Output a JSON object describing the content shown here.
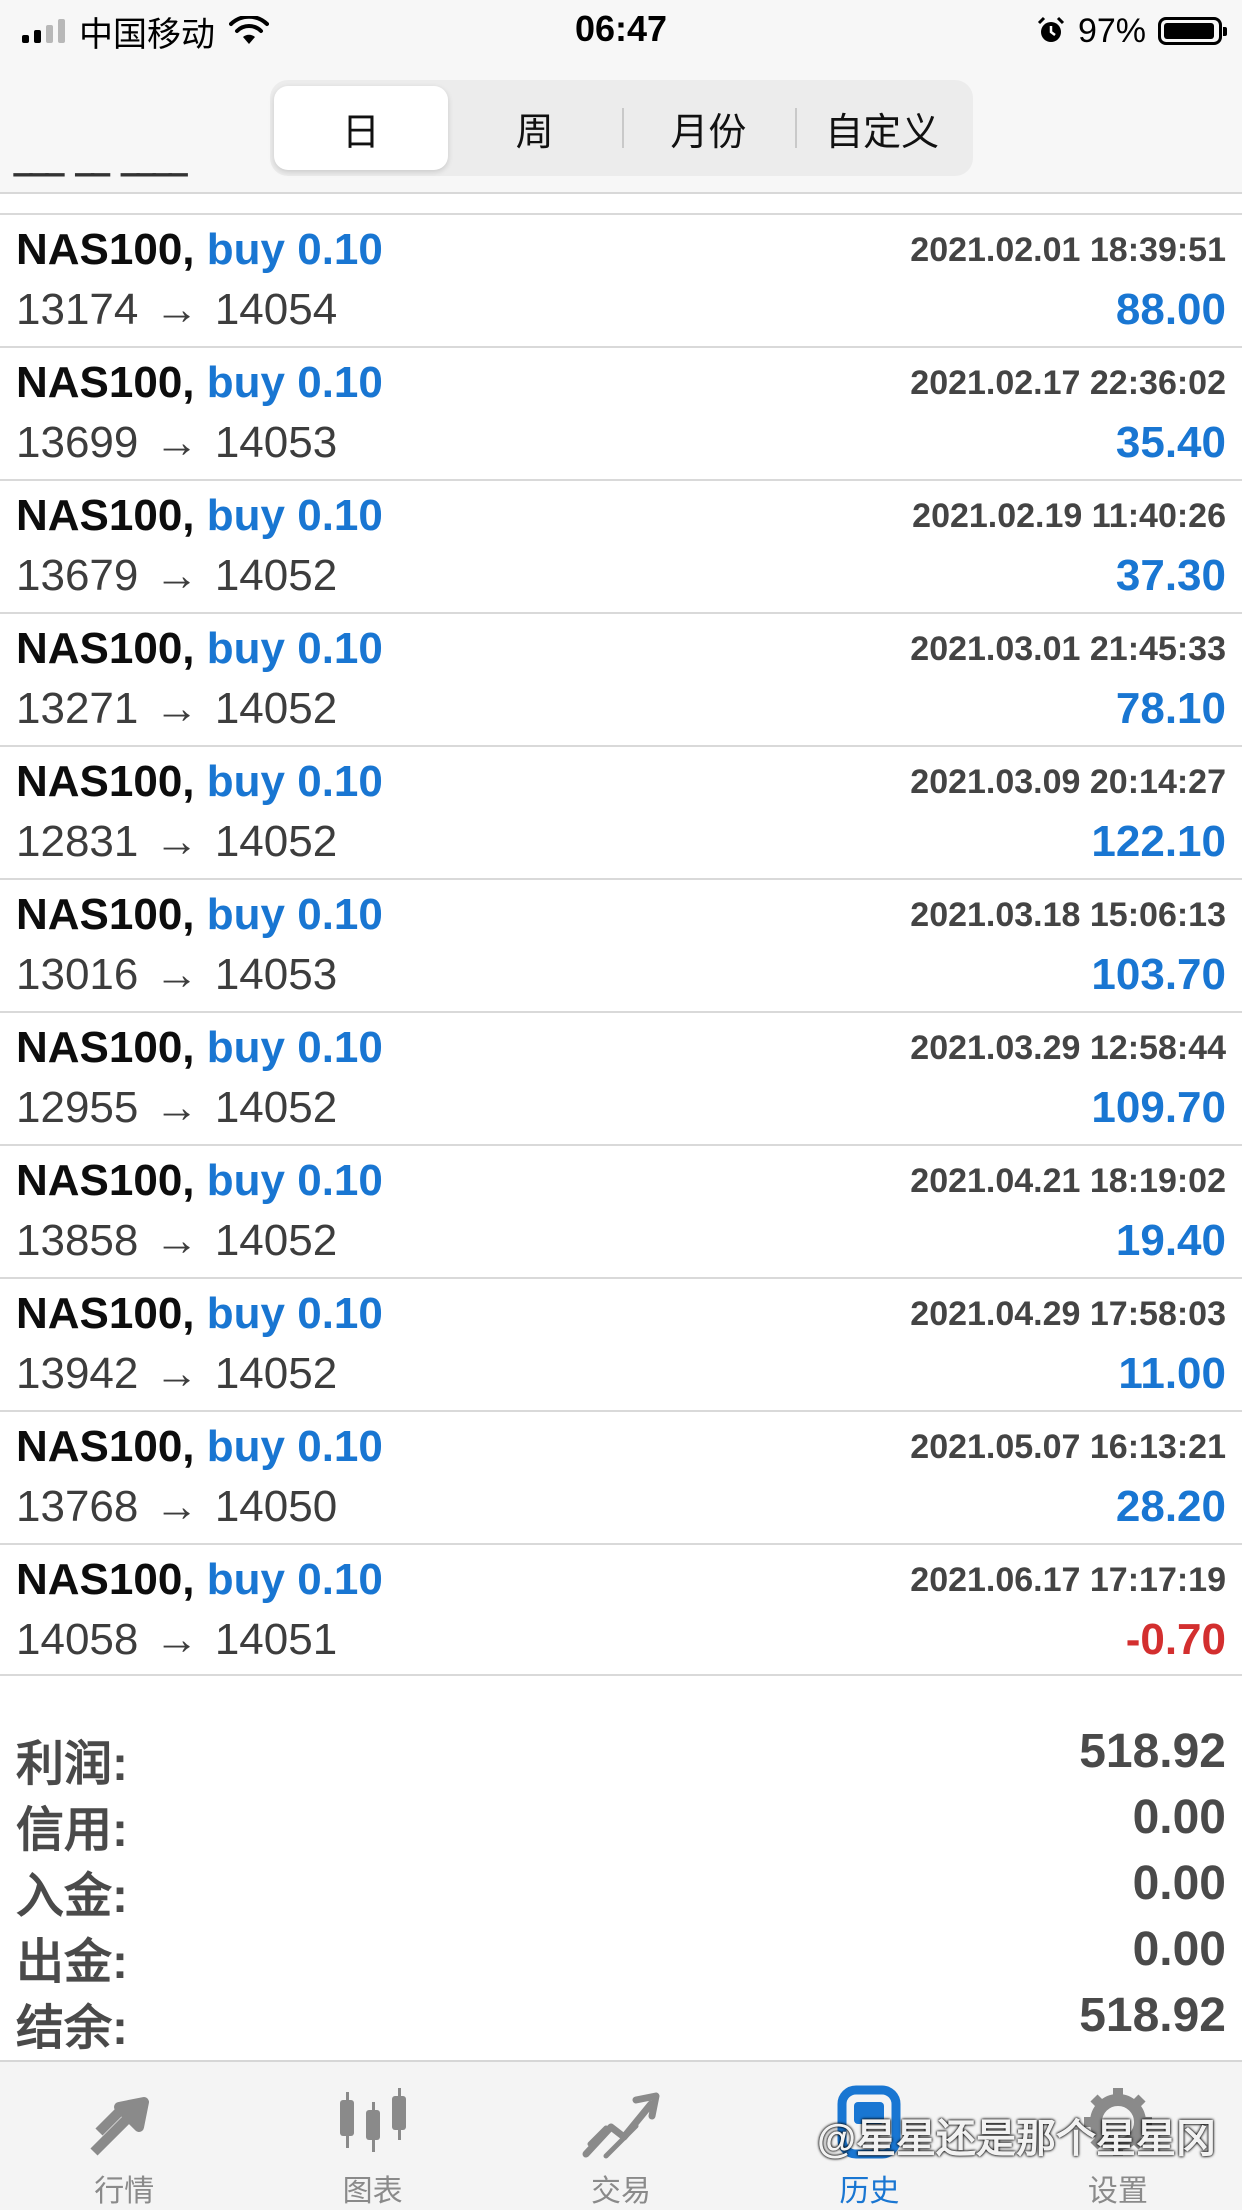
{
  "status_bar": {
    "carrier": "中国移动",
    "time": "06:47",
    "battery": "97%",
    "battery_level": 0.97,
    "signal_bars": 2
  },
  "segments": [
    {
      "label": "日",
      "active": true
    },
    {
      "label": "周",
      "active": false
    },
    {
      "label": "月份",
      "active": false
    },
    {
      "label": "自定义",
      "active": false
    }
  ],
  "trades": [
    {
      "symbol": "NAS100,",
      "side": "buy 0.10",
      "open": "13174",
      "close": "14054",
      "time": "2021.02.01 18:39:51",
      "profit": "88.00",
      "negative": false
    },
    {
      "symbol": "NAS100,",
      "side": "buy 0.10",
      "open": "13699",
      "close": "14053",
      "time": "2021.02.17 22:36:02",
      "profit": "35.40",
      "negative": false
    },
    {
      "symbol": "NAS100,",
      "side": "buy 0.10",
      "open": "13679",
      "close": "14052",
      "time": "2021.02.19 11:40:26",
      "profit": "37.30",
      "negative": false
    },
    {
      "symbol": "NAS100,",
      "side": "buy 0.10",
      "open": "13271",
      "close": "14052",
      "time": "2021.03.01 21:45:33",
      "profit": "78.10",
      "negative": false
    },
    {
      "symbol": "NAS100,",
      "side": "buy 0.10",
      "open": "12831",
      "close": "14052",
      "time": "2021.03.09 20:14:27",
      "profit": "122.10",
      "negative": false
    },
    {
      "symbol": "NAS100,",
      "side": "buy 0.10",
      "open": "13016",
      "close": "14053",
      "time": "2021.03.18 15:06:13",
      "profit": "103.70",
      "negative": false
    },
    {
      "symbol": "NAS100,",
      "side": "buy 0.10",
      "open": "12955",
      "close": "14052",
      "time": "2021.03.29 12:58:44",
      "profit": "109.70",
      "negative": false
    },
    {
      "symbol": "NAS100,",
      "side": "buy 0.10",
      "open": "13858",
      "close": "14052",
      "time": "2021.04.21 18:19:02",
      "profit": "19.40",
      "negative": false
    },
    {
      "symbol": "NAS100,",
      "side": "buy 0.10",
      "open": "13942",
      "close": "14052",
      "time": "2021.04.29 17:58:03",
      "profit": "11.00",
      "negative": false
    },
    {
      "symbol": "NAS100,",
      "side": "buy 0.10",
      "open": "13768",
      "close": "14050",
      "time": "2021.05.07 16:13:21",
      "profit": "28.20",
      "negative": false
    },
    {
      "symbol": "NAS100,",
      "side": "buy 0.10",
      "open": "14058",
      "close": "14051",
      "time": "2021.06.17 17:17:19",
      "profit": "-0.70",
      "negative": true
    }
  ],
  "arrow": "→",
  "summary": [
    {
      "label": "利润:",
      "value": "518.92"
    },
    {
      "label": "信用:",
      "value": "0.00"
    },
    {
      "label": "入金:",
      "value": "0.00"
    },
    {
      "label": "出金:",
      "value": "0.00"
    },
    {
      "label": "结余:",
      "value": "518.92"
    }
  ],
  "tabs": [
    {
      "label": "行情",
      "icon": "quotes-icon",
      "active": false
    },
    {
      "label": "图表",
      "icon": "chart-icon",
      "active": false
    },
    {
      "label": "交易",
      "icon": "trade-icon",
      "active": false
    },
    {
      "label": "历史",
      "icon": "history-icon",
      "active": true
    },
    {
      "label": "设置",
      "icon": "gear-icon",
      "active": false
    }
  ],
  "watermark": "@星星还是那个星星冈",
  "colors": {
    "accent": "#1976d2",
    "negative": "#d32f2f",
    "inactive": "#8a8a8a"
  }
}
